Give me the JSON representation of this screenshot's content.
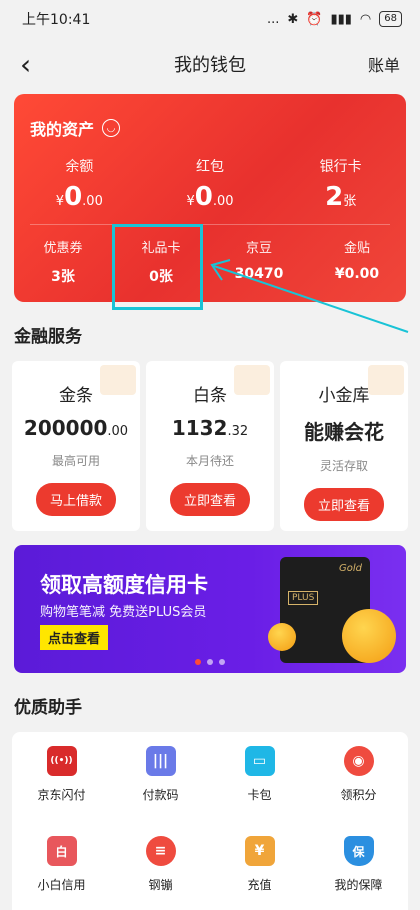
{
  "status": {
    "time": "上午10:41",
    "signal": "...",
    "battery": "68"
  },
  "nav": {
    "back": "‹",
    "title": "我的钱包",
    "bill": "账单"
  },
  "assets": {
    "title": "我的资产",
    "top": [
      {
        "label": "余额",
        "prefix": "¥",
        "int": "0",
        "dec": ".00"
      },
      {
        "label": "红包",
        "prefix": "¥",
        "int": "0",
        "dec": ".00"
      },
      {
        "label": "银行卡",
        "prefix": "",
        "int": "2",
        "dec": "张"
      }
    ],
    "bottom": [
      {
        "label": "优惠券",
        "value": "3张"
      },
      {
        "label": "礼品卡",
        "value": "0张"
      },
      {
        "label": "京豆",
        "value": "30470"
      },
      {
        "label": "金贴",
        "value": "¥0.00"
      }
    ]
  },
  "finance": {
    "title": "金融服务",
    "cards": [
      {
        "name": "金条",
        "int": "200000",
        "dec": ".00",
        "sub": "最高可用",
        "btn": "马上借款"
      },
      {
        "name": "白条",
        "int": "1132",
        "dec": ".32",
        "sub": "本月待还",
        "btn": "立即查看"
      },
      {
        "name": "小金库",
        "int": "能赚会花",
        "dec": "",
        "sub": "灵活存取",
        "btn": "立即查看"
      }
    ]
  },
  "banner": {
    "title": "领取高额度信用卡",
    "subtitle": "购物笔笔减 免费送PLUS会员",
    "button": "点击查看",
    "card_brand": "Gold",
    "card_plus": "PLUS"
  },
  "helpers": {
    "title": "优质助手",
    "items": [
      {
        "label": "京东闪付",
        "icon": "nfc-pay-icon",
        "color": "#d92b2b",
        "glyph": "((•))"
      },
      {
        "label": "付款码",
        "icon": "barcode-icon",
        "color": "#6a7ae8",
        "glyph": "|||"
      },
      {
        "label": "卡包",
        "icon": "card-wallet-icon",
        "color": "#1fb7e6",
        "glyph": "▭"
      },
      {
        "label": "领积分",
        "icon": "coins-icon",
        "color": "#ef4b3f",
        "glyph": "◉"
      },
      {
        "label": "小白信用",
        "icon": "credit-score-icon",
        "color": "#e8575c",
        "glyph": "白"
      },
      {
        "label": "钢镚",
        "icon": "coin-stack-icon",
        "color": "#ef4b3f",
        "glyph": "≡"
      },
      {
        "label": "充值",
        "icon": "recharge-icon",
        "color": "#f0a53a",
        "glyph": "¥"
      },
      {
        "label": "我的保障",
        "icon": "shield-icon",
        "color": "#2b8fe0",
        "glyph": "保"
      }
    ]
  },
  "colors": {
    "accent": "#ec3a2e",
    "annotation": "#19c3d6",
    "banner": "#5b1bd8"
  }
}
